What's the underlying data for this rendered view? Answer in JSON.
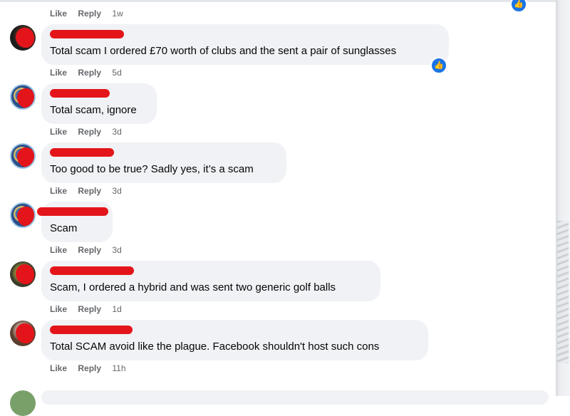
{
  "top": {
    "like": "Like",
    "reply": "Reply",
    "time": "1w"
  },
  "comments": [
    {
      "text": "Total scam I ordered £70 worth of clubs and the sent a pair of sunglasses",
      "like": "Like",
      "reply": "Reply",
      "time": "5d"
    },
    {
      "text": "Total scam, ignore",
      "like": "Like",
      "reply": "Reply",
      "time": "3d"
    },
    {
      "text": "Too good to be true? Sadly yes, it’s a scam",
      "like": "Like",
      "reply": "Reply",
      "time": "3d"
    },
    {
      "text": "Scam",
      "like": "Like",
      "reply": "Reply",
      "time": "3d"
    },
    {
      "text": "Scam, I ordered a hybrid and was sent two generic golf balls",
      "like": "Like",
      "reply": "Reply",
      "time": "1d"
    },
    {
      "text": "Total SCAM avoid like the plague. Facebook shouldn't host such cons",
      "like": "Like",
      "reply": "Reply",
      "time": "11h"
    }
  ],
  "icons": {
    "reaction": "like-thumb-icon",
    "avatar": "avatar"
  },
  "colors": {
    "accent": "#1b74e4",
    "bubble": "#f0f2f5",
    "redaction": "#e3151a",
    "meta": "#65676b"
  }
}
